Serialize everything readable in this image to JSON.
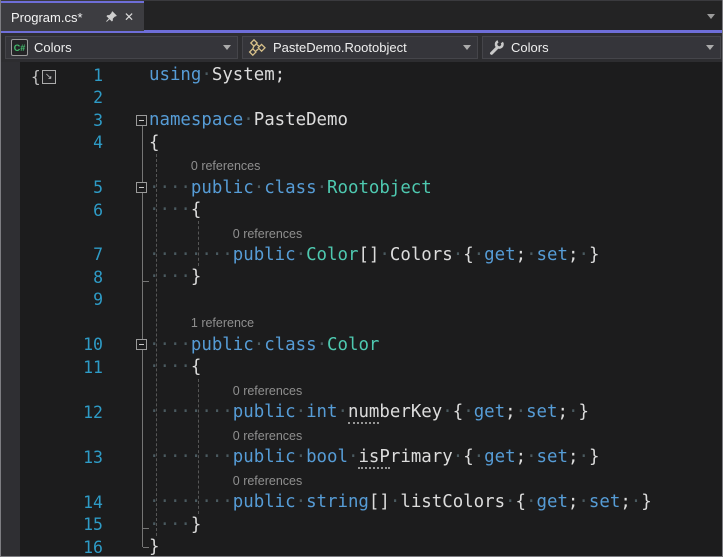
{
  "tab": {
    "title": "Program.cs*",
    "pin_icon": "pushpin",
    "close_icon": "close-x"
  },
  "tabstrip": {
    "overflow_icon": "chevron-down"
  },
  "navbar": {
    "project_dropdown": {
      "label": "Colors",
      "icon": "csharp-project-icon",
      "icon_text": "C#"
    },
    "type_dropdown": {
      "label": "PasteDemo.Rootobject",
      "icon": "class-icon"
    },
    "member_dropdown": {
      "label": "Colors",
      "icon": "property-wrench-icon"
    }
  },
  "editor": {
    "margin_icon": {
      "brace": "{",
      "arrow": "↘"
    },
    "rows": [
      {
        "kind": "code",
        "num": "1",
        "fold": "",
        "tokens": [
          {
            "t": "using",
            "c": "kw"
          },
          {
            "t": "·",
            "c": "ws"
          },
          {
            "t": "System;",
            "c": "plain"
          }
        ]
      },
      {
        "kind": "code",
        "num": "2",
        "fold": "",
        "tokens": []
      },
      {
        "kind": "code",
        "num": "3",
        "fold": "minus",
        "tokens": [
          {
            "t": "namespace",
            "c": "kw"
          },
          {
            "t": "·",
            "c": "ws"
          },
          {
            "t": "PasteDemo",
            "c": "plain"
          }
        ]
      },
      {
        "kind": "code",
        "num": "4",
        "fold": "",
        "tokens": [
          {
            "t": "{",
            "c": "plain"
          }
        ]
      },
      {
        "kind": "lens",
        "text": "0 references",
        "indent": 4
      },
      {
        "kind": "code",
        "num": "5",
        "fold": "minus",
        "tokens": [
          {
            "t": "····",
            "c": "ws"
          },
          {
            "t": "public",
            "c": "kw"
          },
          {
            "t": "·",
            "c": "ws"
          },
          {
            "t": "class",
            "c": "kw"
          },
          {
            "t": "·",
            "c": "ws"
          },
          {
            "t": "Rootobject",
            "c": "type"
          }
        ]
      },
      {
        "kind": "code",
        "num": "6",
        "fold": "",
        "tokens": [
          {
            "t": "····",
            "c": "ws"
          },
          {
            "t": "{",
            "c": "plain"
          }
        ]
      },
      {
        "kind": "lens",
        "text": "0 references",
        "indent": 8
      },
      {
        "kind": "code",
        "num": "7",
        "fold": "",
        "tokens": [
          {
            "t": "········",
            "c": "ws"
          },
          {
            "t": "public",
            "c": "kw"
          },
          {
            "t": "·",
            "c": "ws"
          },
          {
            "t": "Color",
            "c": "type"
          },
          {
            "t": "[]",
            "c": "plain"
          },
          {
            "t": "·",
            "c": "ws"
          },
          {
            "t": "Colors",
            "c": "plain"
          },
          {
            "t": "·",
            "c": "ws"
          },
          {
            "t": "{",
            "c": "plain"
          },
          {
            "t": "·",
            "c": "ws"
          },
          {
            "t": "get",
            "c": "kw"
          },
          {
            "t": ";",
            "c": "plain"
          },
          {
            "t": "·",
            "c": "ws"
          },
          {
            "t": "set",
            "c": "kw"
          },
          {
            "t": ";",
            "c": "plain"
          },
          {
            "t": "·",
            "c": "ws"
          },
          {
            "t": "}",
            "c": "plain"
          }
        ]
      },
      {
        "kind": "code",
        "num": "8",
        "fold": "",
        "tokens": [
          {
            "t": "····",
            "c": "ws"
          },
          {
            "t": "}",
            "c": "plain"
          }
        ]
      },
      {
        "kind": "code",
        "num": "9",
        "fold": "",
        "tokens": []
      },
      {
        "kind": "lens",
        "text": "1 reference",
        "indent": 4
      },
      {
        "kind": "code",
        "num": "10",
        "fold": "minus",
        "tokens": [
          {
            "t": "····",
            "c": "ws"
          },
          {
            "t": "public",
            "c": "kw"
          },
          {
            "t": "·",
            "c": "ws"
          },
          {
            "t": "class",
            "c": "kw"
          },
          {
            "t": "·",
            "c": "ws"
          },
          {
            "t": "Color",
            "c": "type"
          }
        ]
      },
      {
        "kind": "code",
        "num": "11",
        "fold": "",
        "tokens": [
          {
            "t": "····",
            "c": "ws"
          },
          {
            "t": "{",
            "c": "plain"
          }
        ]
      },
      {
        "kind": "lens",
        "text": "0 references",
        "indent": 8
      },
      {
        "kind": "code",
        "num": "12",
        "fold": "",
        "tokens": [
          {
            "t": "········",
            "c": "ws"
          },
          {
            "t": "public",
            "c": "kw"
          },
          {
            "t": "·",
            "c": "ws"
          },
          {
            "t": "int",
            "c": "kw"
          },
          {
            "t": "·",
            "c": "ws"
          },
          {
            "t": "num",
            "c": "sugg"
          },
          {
            "t": "berKey",
            "c": "plain"
          },
          {
            "t": "·",
            "c": "ws"
          },
          {
            "t": "{",
            "c": "plain"
          },
          {
            "t": "·",
            "c": "ws"
          },
          {
            "t": "get",
            "c": "kw"
          },
          {
            "t": ";",
            "c": "plain"
          },
          {
            "t": "·",
            "c": "ws"
          },
          {
            "t": "set",
            "c": "kw"
          },
          {
            "t": ";",
            "c": "plain"
          },
          {
            "t": "·",
            "c": "ws"
          },
          {
            "t": "}",
            "c": "plain"
          }
        ]
      },
      {
        "kind": "lens",
        "text": "0 references",
        "indent": 8
      },
      {
        "kind": "code",
        "num": "13",
        "fold": "",
        "tokens": [
          {
            "t": "········",
            "c": "ws"
          },
          {
            "t": "public",
            "c": "kw"
          },
          {
            "t": "·",
            "c": "ws"
          },
          {
            "t": "bool",
            "c": "kw"
          },
          {
            "t": "·",
            "c": "ws"
          },
          {
            "t": "isP",
            "c": "sugg"
          },
          {
            "t": "rimary",
            "c": "plain"
          },
          {
            "t": "·",
            "c": "ws"
          },
          {
            "t": "{",
            "c": "plain"
          },
          {
            "t": "·",
            "c": "ws"
          },
          {
            "t": "get",
            "c": "kw"
          },
          {
            "t": ";",
            "c": "plain"
          },
          {
            "t": "·",
            "c": "ws"
          },
          {
            "t": "set",
            "c": "kw"
          },
          {
            "t": ";",
            "c": "plain"
          },
          {
            "t": "·",
            "c": "ws"
          },
          {
            "t": "}",
            "c": "plain"
          }
        ]
      },
      {
        "kind": "lens",
        "text": "0 references",
        "indent": 8
      },
      {
        "kind": "code",
        "num": "14",
        "fold": "",
        "tokens": [
          {
            "t": "········",
            "c": "ws"
          },
          {
            "t": "public",
            "c": "kw"
          },
          {
            "t": "·",
            "c": "ws"
          },
          {
            "t": "string",
            "c": "kw"
          },
          {
            "t": "[]",
            "c": "plain"
          },
          {
            "t": "·",
            "c": "ws"
          },
          {
            "t": "listColors",
            "c": "plain"
          },
          {
            "t": "·",
            "c": "ws"
          },
          {
            "t": "{",
            "c": "plain"
          },
          {
            "t": "·",
            "c": "ws"
          },
          {
            "t": "get",
            "c": "kw"
          },
          {
            "t": ";",
            "c": "plain"
          },
          {
            "t": "·",
            "c": "ws"
          },
          {
            "t": "set",
            "c": "kw"
          },
          {
            "t": ";",
            "c": "plain"
          },
          {
            "t": "·",
            "c": "ws"
          },
          {
            "t": "}",
            "c": "plain"
          }
        ]
      },
      {
        "kind": "code",
        "num": "15",
        "fold": "",
        "tokens": [
          {
            "t": "····",
            "c": "ws"
          },
          {
            "t": "}",
            "c": "plain"
          }
        ]
      },
      {
        "kind": "code",
        "num": "16",
        "fold": "",
        "tokens": [
          {
            "t": "}",
            "c": "plain"
          }
        ]
      }
    ]
  },
  "colors": {
    "accent_purple": "#6E6ED8",
    "editor_background": "#1C1C1D",
    "tab_background": "#3D3D41",
    "navbar_background": "#2D2D30",
    "keyword_blue": "#569CD6",
    "type_teal": "#4EC9B0",
    "plain_text": "#DCDCDC",
    "line_number_blue": "#2E9BC6",
    "codelens_gray": "#8F8F8F",
    "whitespace_dot": "#4A5A60",
    "csharp_icon_green": "#44C06F",
    "class_icon_gold": "#D8C18A",
    "wrench_icon_gray": "#C9C9C9"
  }
}
